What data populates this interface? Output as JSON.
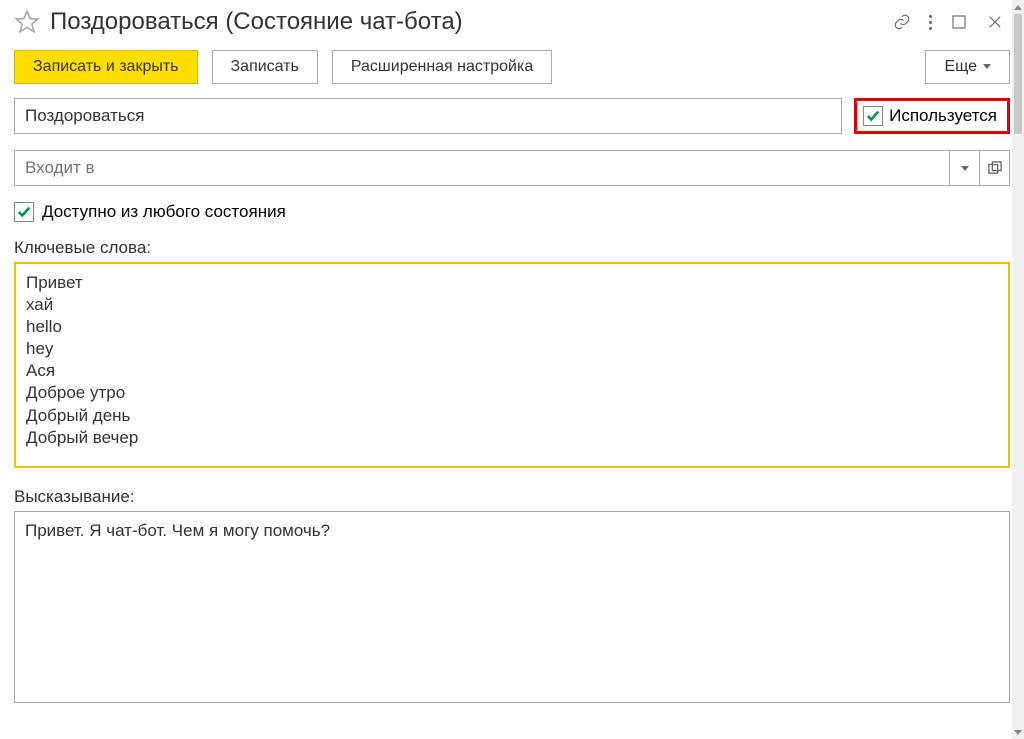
{
  "pageTitle": "Поздороваться (Состояние чат-бота)",
  "toolbar": {
    "saveClose": "Записать и закрыть",
    "save": "Записать",
    "advanced": "Расширенная настройка",
    "more": "Еще"
  },
  "nameField": "Поздороваться",
  "usedLabel": "Используется",
  "usedChecked": true,
  "belongsPlaceholder": "Входит в",
  "anyStateLabel": "Доступно из любого состояния",
  "anyStateChecked": true,
  "keywordsLabel": "Ключевые слова:",
  "keywords": "Привет\nхай\nhello\nhey\nАся\nДоброе утро\nДобрый день\nДобрый вечер",
  "utteranceLabel": "Высказывание:",
  "utterance": "Привет. Я чат-бот. Чем я могу помочь?"
}
